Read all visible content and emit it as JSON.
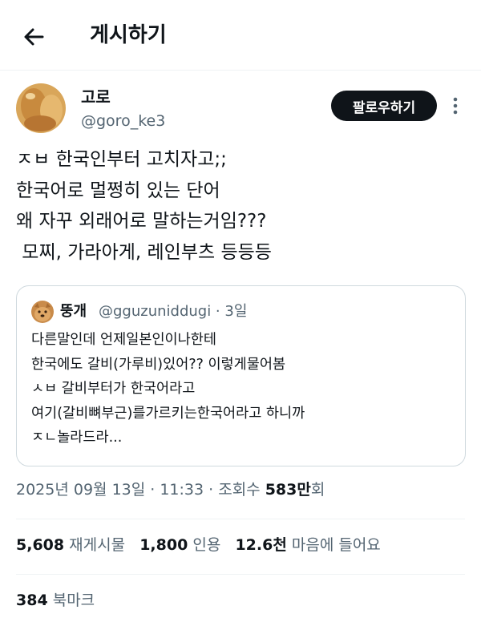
{
  "header": {
    "title": "게시하기",
    "back_icon": "arrow-left-icon"
  },
  "author": {
    "display_name": "고로",
    "handle": "@goro_ke3",
    "follow_label": "팔로우하기",
    "more_icon": "more-vertical-icon"
  },
  "tweet": {
    "lines": [
      "ㅈㅂ 한국인부터 고치자고;;",
      "한국어로 멀쩡히 있는 단어",
      "왜 자꾸 외래어로 말하는거임???",
      " 모찌, 가라아게, 레인부츠 등등등"
    ]
  },
  "quote": {
    "display_name": "뚱개",
    "meta": "@gguzuniddugi · 3일",
    "lines": [
      "다른말인데 언제일본인이나한테",
      "한국에도 갈비(가루비)있어?? 이렇게물어봄",
      "ㅅㅂ 갈비부터가 한국어라고",
      "여기(갈비뼈부근)를가르키는한국어라고 하니까",
      "ㅈㄴ놀라드라..."
    ]
  },
  "meta_row": {
    "datetime": "2025년 09월 13일 · 11:33 · 조회수 ",
    "views": "583만",
    "views_suffix": "회"
  },
  "stats": {
    "reposts_count": "5,608",
    "reposts_label": "재게시물",
    "quotes_count": "1,800",
    "quotes_label": "인용",
    "likes_count": "12.6천",
    "likes_label": "마음에 들어요",
    "bookmarks_count": "384",
    "bookmarks_label": "북마크"
  },
  "colors": {
    "text": "#0f1419",
    "muted": "#536471",
    "border": "#cfd9de",
    "divider": "#eff3f4",
    "button_bg": "#0f1419"
  }
}
